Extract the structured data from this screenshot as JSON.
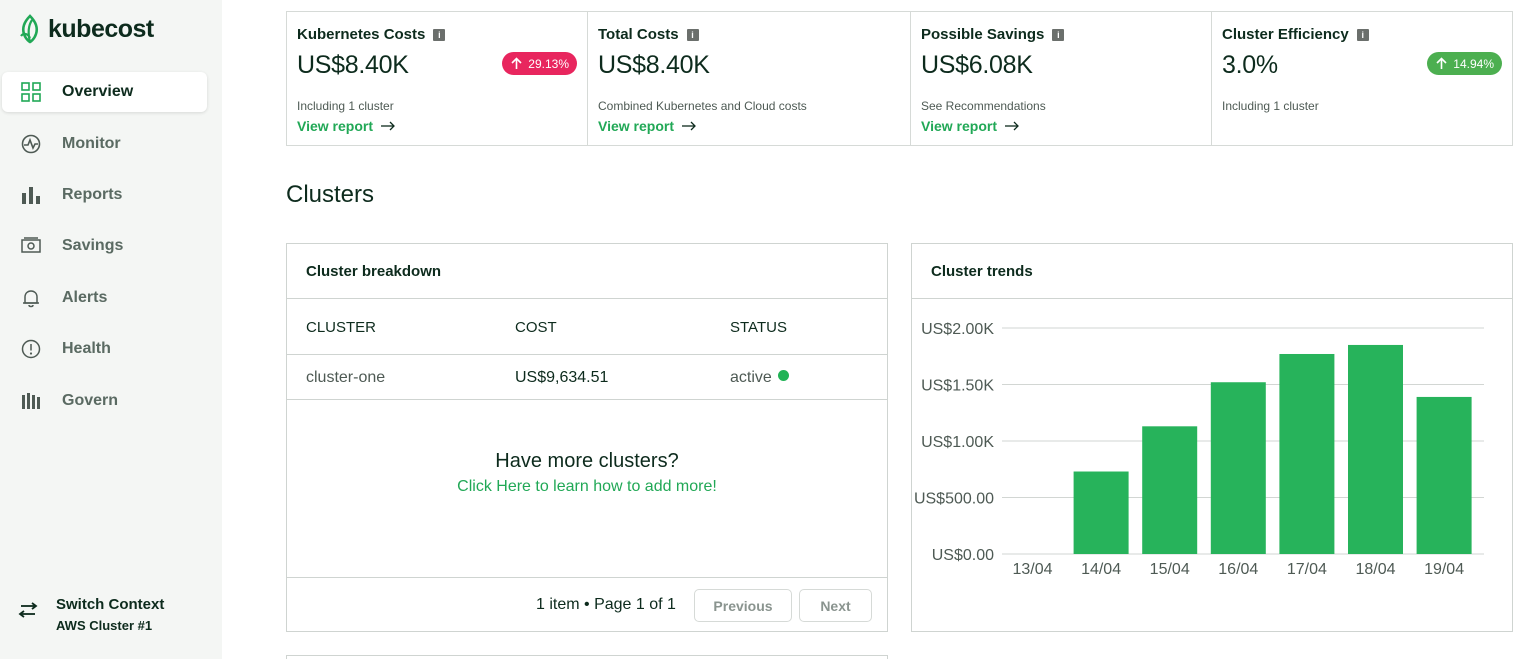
{
  "brand": {
    "name": "kubecost",
    "color": "#21a856"
  },
  "sidebar": {
    "items": [
      {
        "label": "Overview",
        "icon": "grid-icon",
        "active": true
      },
      {
        "label": "Monitor",
        "icon": "pulse-icon",
        "active": false
      },
      {
        "label": "Reports",
        "icon": "bar-chart-icon",
        "active": false
      },
      {
        "label": "Savings",
        "icon": "money-icon",
        "active": false
      },
      {
        "label": "Alerts",
        "icon": "bell-icon",
        "active": false
      },
      {
        "label": "Health",
        "icon": "alert-circle-icon",
        "active": false
      },
      {
        "label": "Govern",
        "icon": "govern-icon",
        "active": false
      }
    ],
    "switch_context": {
      "title": "Switch Context",
      "subtitle": "AWS Cluster #1",
      "icon": "swap-icon"
    }
  },
  "kpis": [
    {
      "title": "Kubernetes Costs",
      "value": "US$8.40K",
      "badge": "29.13%",
      "badge_color": "#e8265e",
      "description": "Including 1 cluster",
      "link": "View report"
    },
    {
      "title": "Total Costs",
      "value": "US$8.40K",
      "badge": "",
      "description": "Combined Kubernetes and Cloud costs",
      "link": "View report"
    },
    {
      "title": "Possible Savings",
      "value": "US$6.08K",
      "badge": "",
      "description": "See Recommendations",
      "link": "View report"
    },
    {
      "title": "Cluster Efficiency",
      "value": "3.0%",
      "badge": "14.94%",
      "badge_color": "#4caf50",
      "description": "Including 1 cluster",
      "link": ""
    }
  ],
  "clusters": {
    "title": "Clusters",
    "breakdown": {
      "title": "Cluster breakdown",
      "columns": [
        "CLUSTER",
        "COST",
        "STATUS"
      ],
      "rows": [
        {
          "cluster": "cluster-one",
          "cost": "US$9,634.51",
          "status": "active"
        }
      ],
      "more_title": "Have more clusters?",
      "more_link": "Click Here to learn how to add more!",
      "pagination": "1 item • Page 1 of 1",
      "prev_label": "Previous",
      "next_label": "Next"
    },
    "trends": {
      "title": "Cluster trends"
    }
  },
  "chart_data": {
    "type": "bar",
    "categories": [
      "13/04",
      "14/04",
      "15/04",
      "16/04",
      "17/04",
      "18/04",
      "19/04"
    ],
    "values": [
      0,
      730,
      1130,
      1520,
      1770,
      1850,
      1390
    ],
    "yticks": [
      "US$0.00",
      "US$500.00",
      "US$1.00K",
      "US$1.50K",
      "US$2.00K"
    ],
    "ylim": [
      0,
      2000
    ],
    "bar_color": "#27b35b",
    "grid": true
  }
}
